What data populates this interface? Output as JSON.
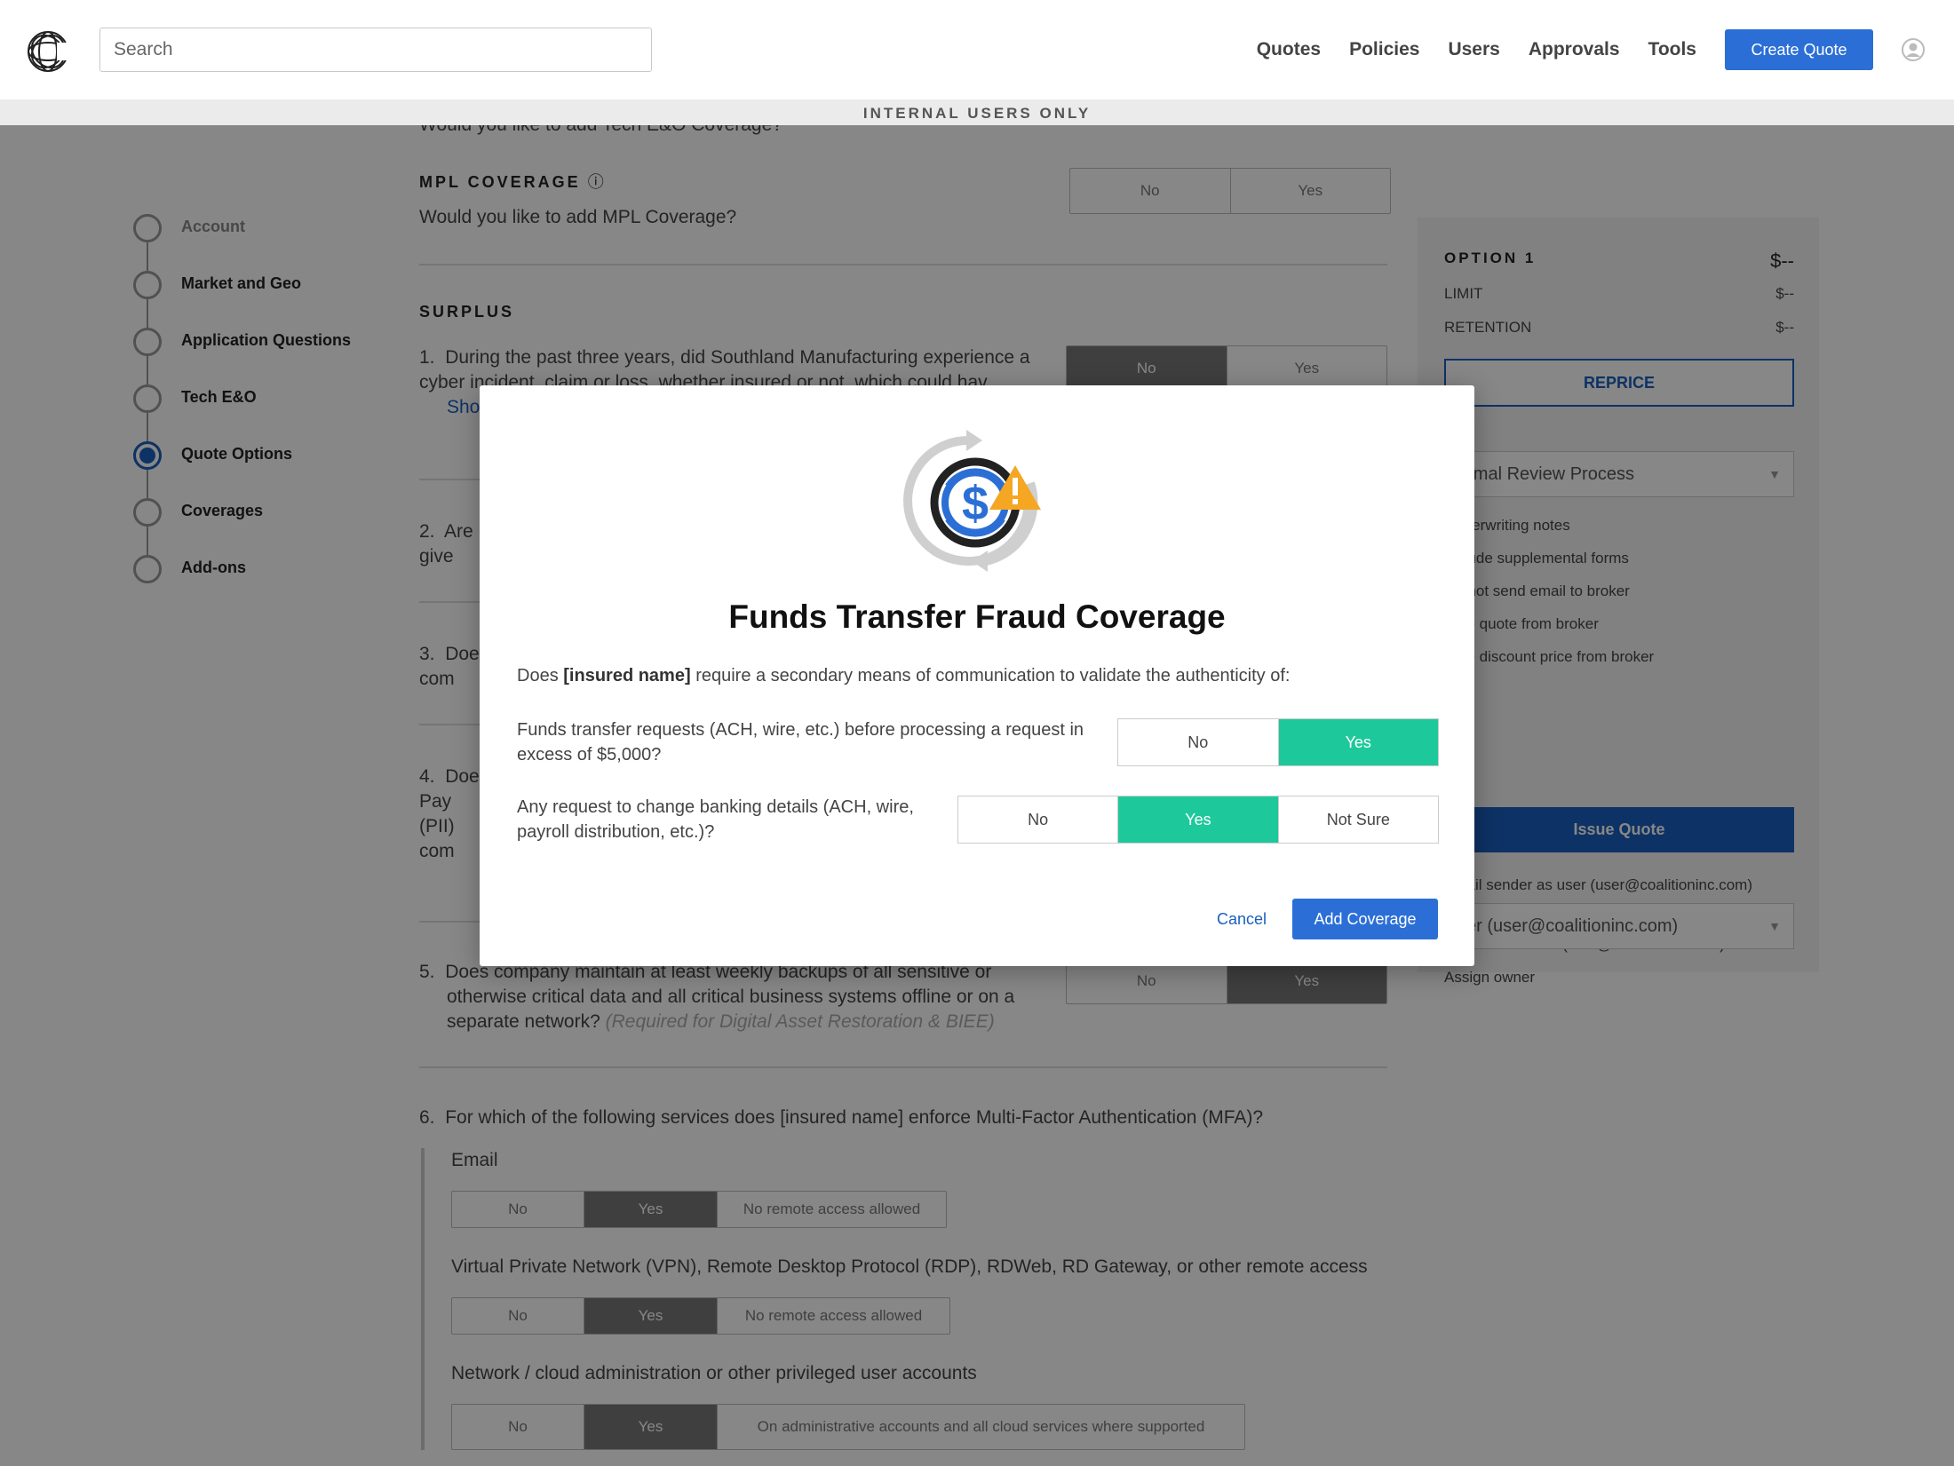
{
  "header": {
    "search_placeholder": "Search",
    "nav": [
      "Quotes",
      "Policies",
      "Users",
      "Approvals",
      "Tools"
    ],
    "create_quote": "Create Quote"
  },
  "banner": "INTERNAL USERS ONLY",
  "steps": [
    {
      "label": "Account",
      "state": "muted"
    },
    {
      "label": "Market and Geo",
      "state": "done"
    },
    {
      "label": "Application Questions",
      "state": "done"
    },
    {
      "label": "Tech E&O",
      "state": "done"
    },
    {
      "label": "Quote Options",
      "state": "active"
    },
    {
      "label": "Coverages",
      "state": "done"
    },
    {
      "label": "Add-ons",
      "state": "done"
    }
  ],
  "form": {
    "tech_eo_q": "Would you like to add Tech E&O Coverage?",
    "mpl_title": "MPL COVERAGE",
    "mpl_q": "Would you like to add MPL Coverage?",
    "no": "No",
    "yes": "Yes",
    "surplus_title": "SURPLUS",
    "q1": "During the past three years, did Southland Manufacturing experience a cyber incident, claim or loss, whether insured or not, which could hav",
    "q1_link": "Sho",
    "q2": "Are give",
    "q3": "Doe com",
    "q4": "Doe Pay (PII) com",
    "q5": "Does company maintain at least weekly backups of all sensitive or otherwise critical data and all critical business systems offline or on a separate network?",
    "q5_note": "(Required for Digital Asset Restoration & BIEE)",
    "q6": "For which of the following services does [insured name] enforce Multi-Factor Authentication (MFA)?",
    "email": "Email",
    "vpn": "Virtual Private Network (VPN), Remote Desktop Protocol (RDP), RDWeb, RD Gateway, or other remote access",
    "network": "Network / cloud administration or other privileged user accounts",
    "no_remote": "No remote access allowed",
    "admin_accounts": "On administrative accounts and all cloud services where supported"
  },
  "sidebar": {
    "option": "OPTION 1",
    "option_value": "$--",
    "limit": "LIMIT",
    "limit_value": "$--",
    "retention": "RETENTION",
    "retention_value": "$--",
    "reprice": "REPRICE",
    "review_process": "ormal Review Process",
    "checks": [
      "Underwriting notes",
      "Include supplemental forms",
      "Do not send email to broker",
      "Hide quote from broker",
      "Hide discount price from broker"
    ],
    "issue_quote": "Issue Quote",
    "email_sender": "Email sender as user (user@coalitioninc.com)",
    "email_cc": "Email CC to user (user@coalitioninc.com)",
    "assign_owner": "Assign owner",
    "owner_value": "ser (user@coalitioninc.com)"
  },
  "modal": {
    "title": "Funds Transfer Fraud Coverage",
    "intro_prefix": "Does",
    "intro_bold": "[insured name]",
    "intro_suffix": "require a secondary means of communication to validate the authenticity of:",
    "q1": "Funds transfer requests (ACH, wire, etc.) before processing a request in excess of $5,000?",
    "q1_no": "No",
    "q1_yes": "Yes",
    "q1_selected": "Yes",
    "q2": "Any request to change banking details (ACH, wire, payroll distribution, etc.)?",
    "q2_no": "No",
    "q2_yes": "Yes",
    "q2_not_sure": "Not Sure",
    "q2_selected": "Yes",
    "cancel": "Cancel",
    "add": "Add Coverage"
  },
  "colors": {
    "primary": "#2b6fd6",
    "selected": "#1dc99a",
    "warning": "#f5a623"
  }
}
